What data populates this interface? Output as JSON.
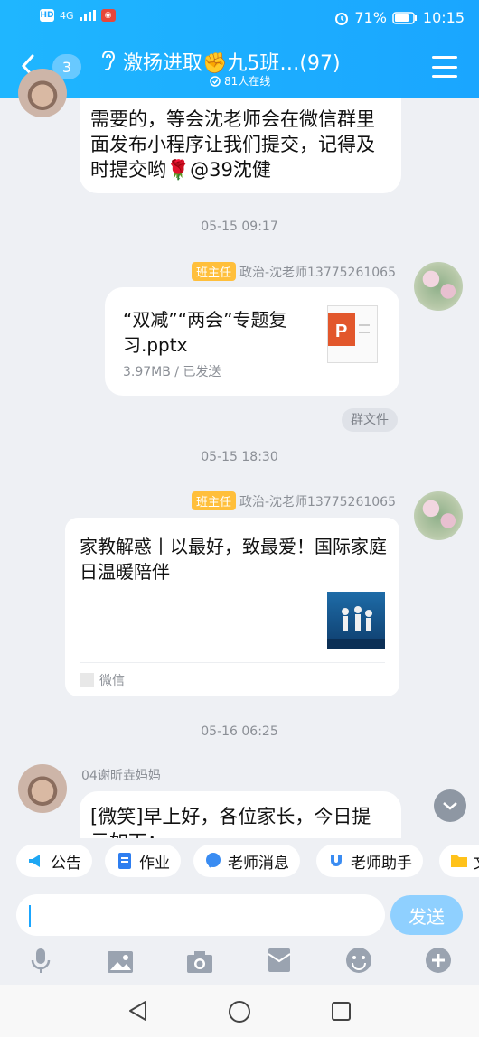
{
  "status_bar": {
    "left_chips": [
      "HD",
      "4G"
    ],
    "alarm_icon": "alarm-icon",
    "battery": "71%",
    "time": "10:15"
  },
  "header": {
    "unread_count": "3",
    "title": "激扬进取✊九5班…(97)",
    "online": "81人在线"
  },
  "messages": {
    "m1_text": "需要的，等会沈老师会在微信群里面发布小程序让我们提交，记得及时提交哟🌹@39沈健",
    "ts1": "05-15 09:17",
    "m2_role": "班主任",
    "m2_sender": "政治-沈老师13775261065",
    "m2_file_name": "“双减”“两会”专题复习.pptx",
    "m2_file_meta": "3.97MB / 已发送",
    "m2_tag": "群文件",
    "ts2": "05-15 18:30",
    "m3_role": "班主任",
    "m3_sender": "政治-沈老师13775261065",
    "m3_title": "家教解惑丨以最好，致最爱！国际家庭日温暖陪伴",
    "m3_source": "微信",
    "ts3": "05-16 06:25",
    "m4_sender": "04谢昕垚妈妈",
    "m4_text": "[微笑]早上好，各位家长，今日提示如下："
  },
  "shortcuts": [
    "公告",
    "作业",
    "老师消息",
    "老师助手",
    "文"
  ],
  "input": {
    "value": "",
    "send_label": "发送"
  },
  "colors": {
    "header": "#1aa6ff",
    "send": "#8fd0ff",
    "role": "#ffbf3b"
  }
}
